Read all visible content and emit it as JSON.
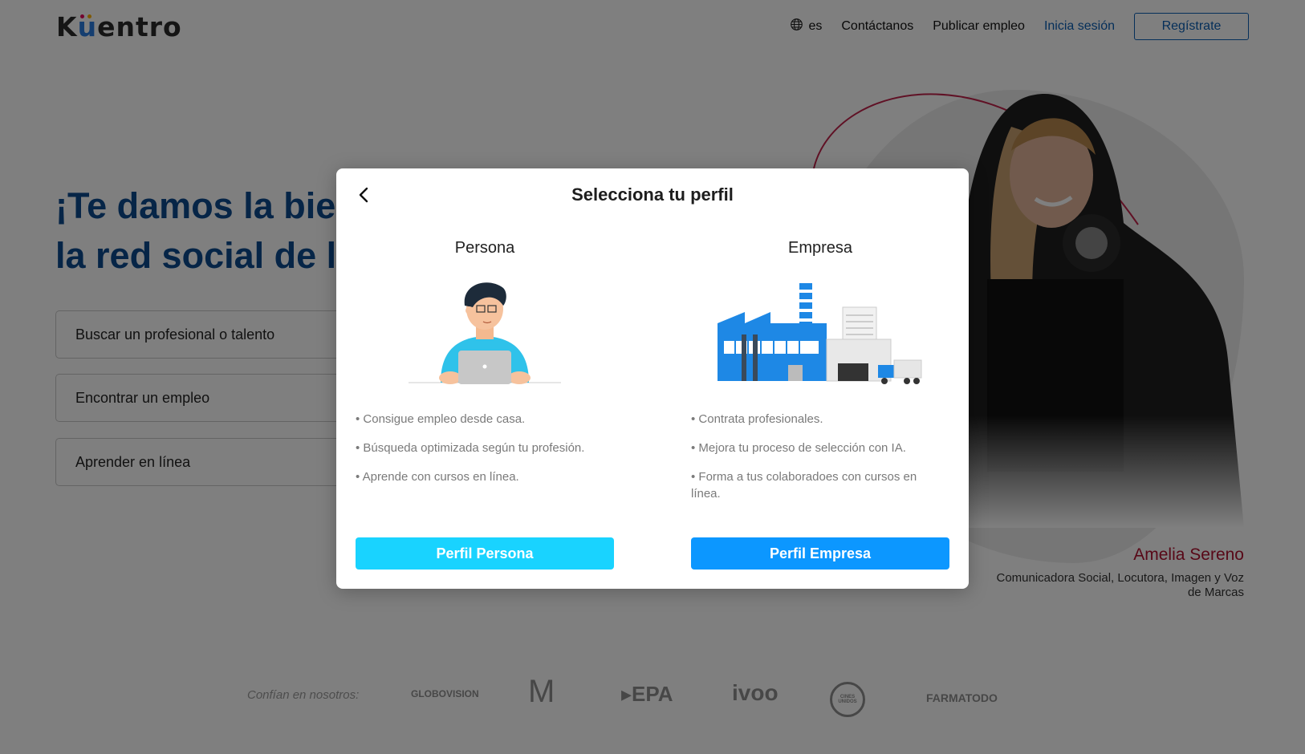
{
  "header": {
    "logo": "Kuentro",
    "language": "es",
    "nav": {
      "contact": "Contáctanos",
      "post_job": "Publicar empleo",
      "login": "Inicia sesión",
      "register": "Regístrate"
    }
  },
  "hero": {
    "title": "¡Te damos la bie\nla red social de l",
    "options": [
      "Buscar un profesional o talento",
      "Encontrar un empleo",
      "Aprender en línea"
    ]
  },
  "featured": {
    "name": "Amelia Sereno",
    "role": "Comunicadora Social, Locutora, Imagen y Voz de Marcas"
  },
  "trust": {
    "label": "Confían en nosotros:",
    "brands": [
      "GLOBOVISION",
      "M",
      "▸EPA",
      "ivoo",
      "CINES UNIDOS",
      "FARMATODO"
    ]
  },
  "modal": {
    "title": "Selecciona tu perfil",
    "persona": {
      "title": "Persona",
      "features": [
        "• Consigue empleo desde casa.",
        "• Búsqueda optimizada según tu profesión.",
        "• Aprende con cursos en línea."
      ],
      "button": "Perfil Persona"
    },
    "empresa": {
      "title": "Empresa",
      "features": [
        "• Contrata profesionales.",
        "• Mejora tu proceso de selección con IA.",
        "• Forma a tus colaboradoes con cursos en línea."
      ],
      "button": "Perfil Empresa"
    }
  },
  "colors": {
    "primary": "#0b5fb4",
    "persona_button": "#19d3ff",
    "empresa_button": "#0c97ff",
    "accent_name": "#b0102f"
  },
  "icons": {
    "globe": "globe-icon",
    "back": "chevron-left-icon"
  }
}
